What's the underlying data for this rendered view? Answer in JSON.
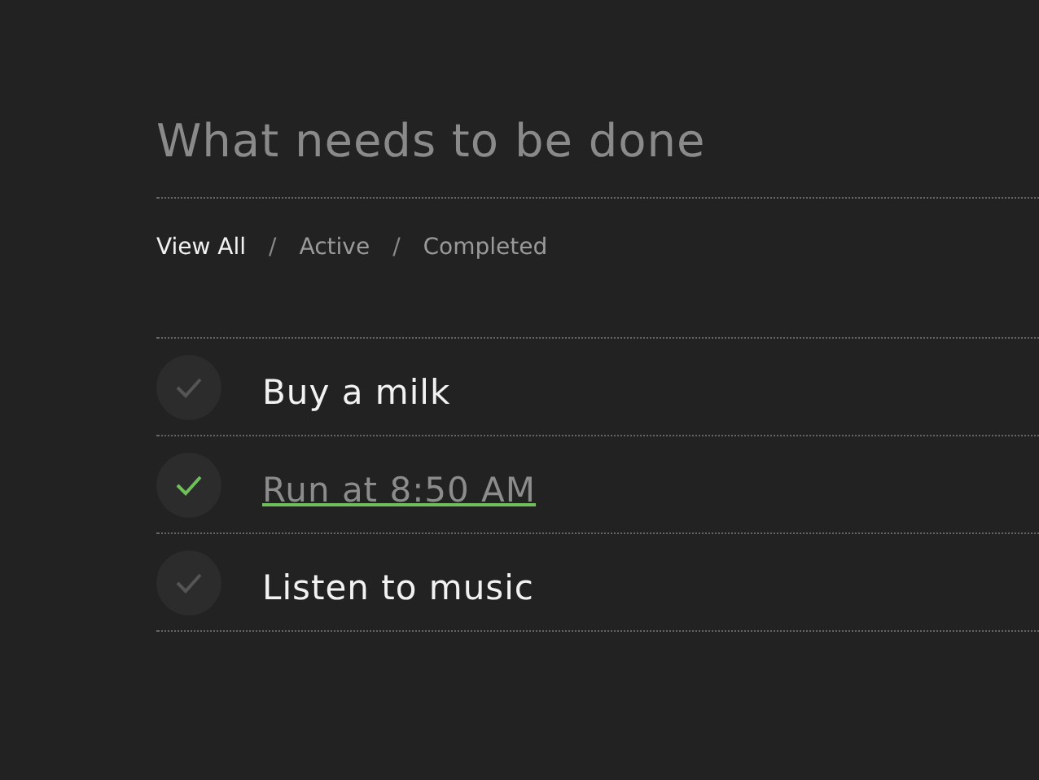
{
  "new_todo": {
    "placeholder": "What needs to be done"
  },
  "filters": [
    {
      "label": "View All",
      "selected": true
    },
    {
      "label": "Active",
      "selected": false
    },
    {
      "label": "Completed",
      "selected": false
    }
  ],
  "filter_separators": [
    "/",
    "/"
  ],
  "todos": [
    {
      "text": "Buy a milk",
      "completed": false
    },
    {
      "text": "Run at 8:50 AM",
      "completed": true
    },
    {
      "text": "Listen to music",
      "completed": false
    }
  ]
}
